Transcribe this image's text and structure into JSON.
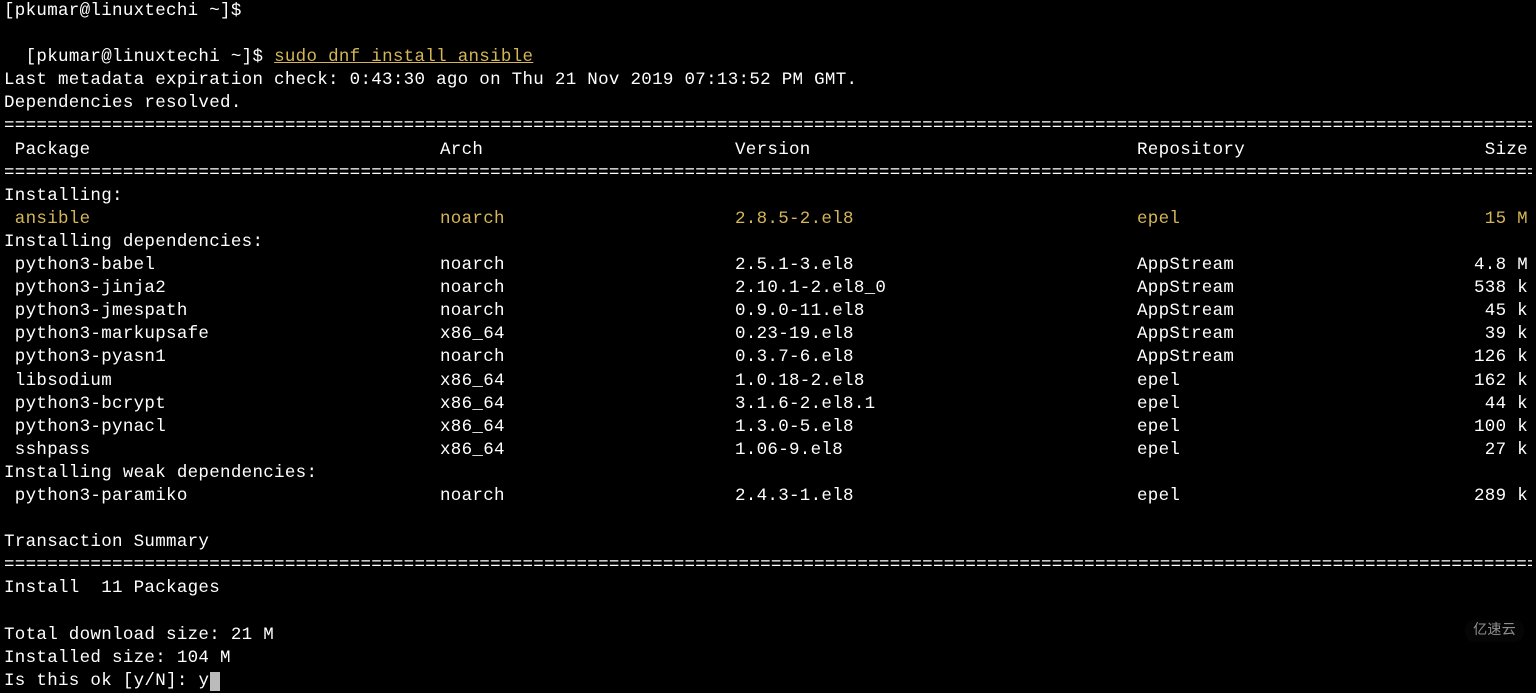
{
  "truncated_top": "[pkumar@linuxtechi ~]$",
  "prompt": "[pkumar@linuxtechi ~]$ ",
  "command": "sudo dnf install ansible",
  "metadata_line": "Last metadata expiration check: 0:43:30 ago on Thu 21 Nov 2019 07:13:52 PM GMT.",
  "deps_resolved": "Dependencies resolved.",
  "headers": {
    "package": " Package",
    "arch": "Arch",
    "version": "Version",
    "repository": "Repository",
    "size": "Size"
  },
  "sections": {
    "installing": "Installing:",
    "installing_deps": "Installing dependencies:",
    "installing_weak": "Installing weak dependencies:"
  },
  "main_pkg": {
    "name": " ansible",
    "arch": "noarch",
    "version": "2.8.5-2.el8",
    "repo": "epel",
    "size": "15 M"
  },
  "deps": [
    {
      "name": " python3-babel",
      "arch": "noarch",
      "version": "2.5.1-3.el8",
      "repo": "AppStream",
      "size": "4.8 M"
    },
    {
      "name": " python3-jinja2",
      "arch": "noarch",
      "version": "2.10.1-2.el8_0",
      "repo": "AppStream",
      "size": "538 k"
    },
    {
      "name": " python3-jmespath",
      "arch": "noarch",
      "version": "0.9.0-11.el8",
      "repo": "AppStream",
      "size": "45 k"
    },
    {
      "name": " python3-markupsafe",
      "arch": "x86_64",
      "version": "0.23-19.el8",
      "repo": "AppStream",
      "size": "39 k"
    },
    {
      "name": " python3-pyasn1",
      "arch": "noarch",
      "version": "0.3.7-6.el8",
      "repo": "AppStream",
      "size": "126 k"
    },
    {
      "name": " libsodium",
      "arch": "x86_64",
      "version": "1.0.18-2.el8",
      "repo": "epel",
      "size": "162 k"
    },
    {
      "name": " python3-bcrypt",
      "arch": "x86_64",
      "version": "3.1.6-2.el8.1",
      "repo": "epel",
      "size": "44 k"
    },
    {
      "name": " python3-pynacl",
      "arch": "x86_64",
      "version": "1.3.0-5.el8",
      "repo": "epel",
      "size": "100 k"
    },
    {
      "name": " sshpass",
      "arch": "x86_64",
      "version": "1.06-9.el8",
      "repo": "epel",
      "size": "27 k"
    }
  ],
  "weak": [
    {
      "name": " python3-paramiko",
      "arch": "noarch",
      "version": "2.4.3-1.el8",
      "repo": "epel",
      "size": "289 k"
    }
  ],
  "summary_heading": "Transaction Summary",
  "install_count": "Install  11 Packages",
  "total_download": "Total download size: 21 M",
  "installed_size": "Installed size: 104 M",
  "confirm_prompt": "Is this ok [y/N]: ",
  "confirm_input": "y",
  "watermark": "亿速云",
  "hr": "================================================================================================================================================================================================================================"
}
